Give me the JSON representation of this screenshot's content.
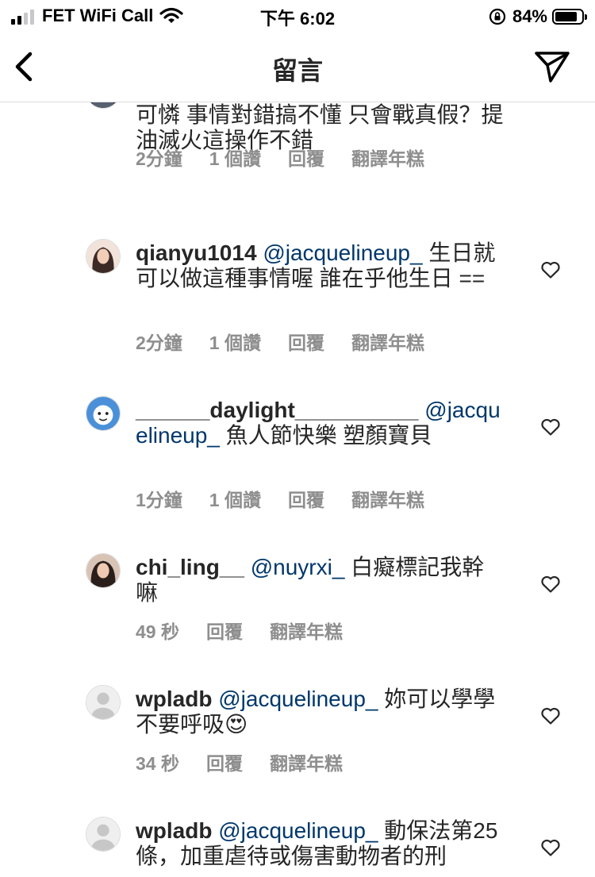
{
  "status_bar": {
    "carrier": "FET WiFi Call",
    "time": "下午 6:02",
    "battery_percent_text": "84%",
    "battery_level": 0.84,
    "icons": [
      "signal-icon",
      "wifi-icon",
      "orientation-lock-icon",
      "battery-icon"
    ]
  },
  "nav": {
    "title": "留言",
    "icons": [
      "back-arrow-icon",
      "send-icon"
    ]
  },
  "colors": {
    "text": "#262626",
    "mention": "#00376b",
    "meta": "#8e8e8e",
    "divider": "#dbdbdb"
  },
  "comments": [
    {
      "body": "可憐 事情對錯搞不懂 只會戰真假？提油滅火這操作不錯",
      "time": "2分鐘",
      "likes": "1 個讚",
      "reply": "回覆",
      "translate": "翻譯年糕",
      "avatar_icon": "avatar-dark-icon"
    },
    {
      "username": "qianyu1014",
      "mention": "@jacquelineup_",
      "text": "生日就可以做這種事情喔 誰在乎他生日 ==",
      "time": "2分鐘",
      "likes": "1 個讚",
      "reply": "回覆",
      "translate": "翻譯年糕",
      "avatar_icon": "avatar-portrait-icon"
    },
    {
      "username": "______daylight__________",
      "mention": "@jacquelineup_",
      "text": "魚人節快樂 塑顏寶貝",
      "time": "1分鐘",
      "likes": "1 個讚",
      "reply": "回覆",
      "translate": "翻譯年糕",
      "avatar_icon": "avatar-cartoon-icon"
    },
    {
      "username": "chi_ling__",
      "mention": "@nuyrxi_",
      "text": "白癡標記我幹嘛",
      "time": "49 秒",
      "reply": "回覆",
      "translate": "翻譯年糕",
      "avatar_icon": "avatar-portrait-icon"
    },
    {
      "username": "wpladb",
      "mention": "@jacquelineup_",
      "text": "妳可以學學不要呼吸😍",
      "time": "34 秒",
      "reply": "回覆",
      "translate": "翻譯年糕",
      "avatar_icon": "avatar-default-icon"
    },
    {
      "username": "wpladb",
      "mention": "@jacquelineup_",
      "text": "動保法第25條，加重虐待或傷害動物者的刑",
      "avatar_icon": "avatar-default-icon"
    }
  ]
}
